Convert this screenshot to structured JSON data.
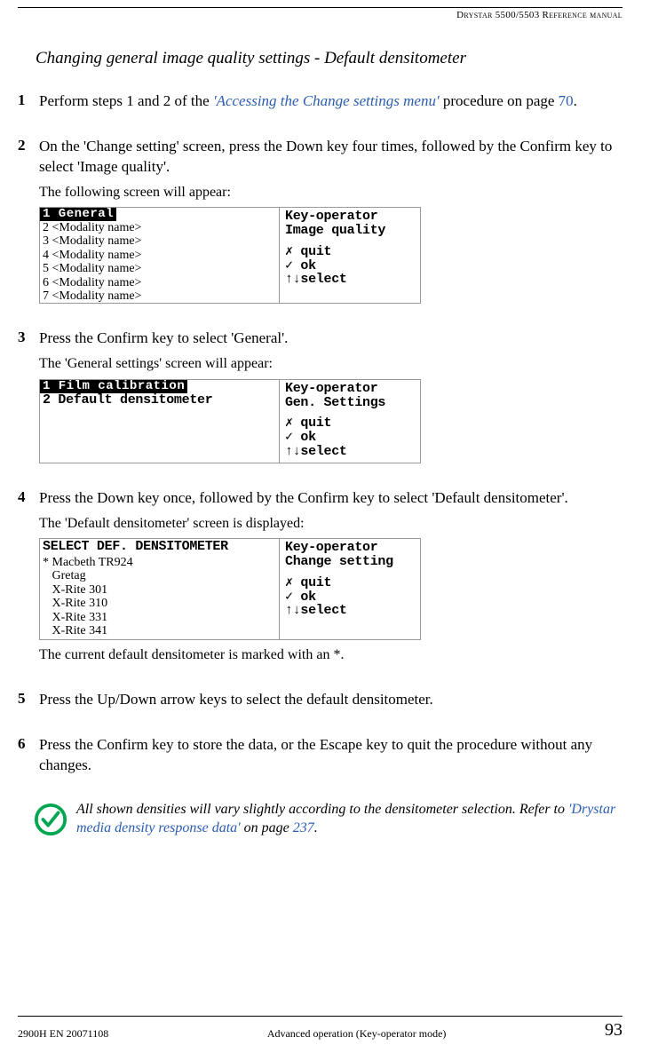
{
  "header": {
    "manual": "Drystar 5500/5503 Reference manual"
  },
  "title": "Changing general image quality settings - Default densitometer",
  "steps": [
    {
      "num": "1",
      "text_pre": "Perform steps 1 and 2 of the ",
      "link": "'Accessing the Change settings menu'",
      "text_mid": " procedure on page ",
      "page_link": "70",
      "text_post": "."
    },
    {
      "num": "2",
      "text": "On the 'Change setting' screen, press the Down key four times, followed by the Confirm key to select 'Image quality'.",
      "follow": "The following screen will appear:"
    },
    {
      "num": "3",
      "text": "Press the Confirm key to select 'General'.",
      "follow": "The 'General settings' screen will appear:"
    },
    {
      "num": "4",
      "text": "Press the Down key once, followed by the Confirm key to select 'Default densitometer'.",
      "follow": "The 'Default densitometer' screen is displayed:",
      "after": "The current default densitometer is marked with an *."
    },
    {
      "num": "5",
      "text": "Press the Up/Down arrow keys to select the default densitometer."
    },
    {
      "num": "6",
      "text": "Press the Confirm key to store the data, or the Escape key to quit the procedure without any changes."
    }
  ],
  "lcd1": {
    "hl": "1 General",
    "rows": [
      "2 <Modality name>",
      "3 <Modality name>",
      "4 <Modality name>",
      "5 <Modality name>",
      "6 <Modality name>",
      "7 <Modality name>"
    ],
    "right_title_a": "Key-operator",
    "right_title_b": "Image quality",
    "actions": [
      "✗ quit",
      "✓ ok",
      "↑↓select"
    ]
  },
  "lcd2": {
    "hl": "1 Film calibration",
    "rows": [
      "2 Default densitometer"
    ],
    "right_title_a": "Key-operator",
    "right_title_b": "Gen. Settings",
    "actions": [
      "✗ quit",
      "✓ ok",
      "↑↓select"
    ]
  },
  "lcd3": {
    "title": "SELECT DEF. DENSITOMETER",
    "rows": [
      "* Macbeth TR924",
      "   Gretag",
      "   X-Rite 301",
      "   X-Rite 310",
      "   X-Rite 331",
      "   X-Rite 341"
    ],
    "right_title_a": "Key-operator",
    "right_title_b": "Change setting",
    "actions": [
      "✗ quit",
      "✓ ok",
      "↑↓select"
    ]
  },
  "note": {
    "text_pre": "All shown densities will vary slightly according to the densitometer selection. Refer to ",
    "link": "'Drystar media density response data'",
    "text_mid": " on page ",
    "page_link": "237",
    "text_post": "."
  },
  "footer": {
    "left": "2900H EN 20071108",
    "center": "Advanced operation (Key-operator mode)",
    "page": "93"
  }
}
